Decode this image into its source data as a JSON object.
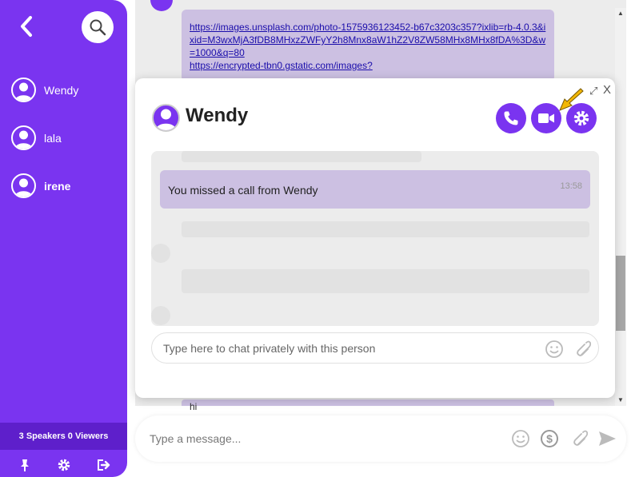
{
  "sidebar": {
    "users": [
      {
        "name": "Wendy"
      },
      {
        "name": "lala"
      },
      {
        "name": "irene"
      }
    ],
    "audience_count": "3 Speakers 0 Viewers",
    "icons": [
      "pin-icon",
      "gear-icon",
      "exit-icon"
    ]
  },
  "background_chat": {
    "link_text": "https://images.unsplash.com/photo-1575936123452-b67c3203c357?ixlib=rb-4.0.3&ixid=M3wxMjA3fDB8MHxzZWFyY2h8Mnx8aW1hZ2V8ZW58MHx8MHx8fDA%3D&w=1000&q=80",
    "link_text_2": "https://encrypted-tbn0.gstatic.com/images?",
    "bottom_text": "hi"
  },
  "main_input": {
    "placeholder": "Type a message..."
  },
  "private_chat": {
    "title": "Wendy",
    "expand_symbol": "⤢",
    "close_symbol": "X",
    "messages": [
      {
        "text": "You missed a call from Wendy",
        "time": "13:58"
      }
    ],
    "input_placeholder": "Type here to chat privately with this person"
  },
  "colors": {
    "accent": "#7a34f0",
    "sidebar_dark": "#5e1fcb",
    "bubble": "#ccc0e2",
    "chat_bg": "#ececec",
    "pointer": "#f2b705"
  }
}
